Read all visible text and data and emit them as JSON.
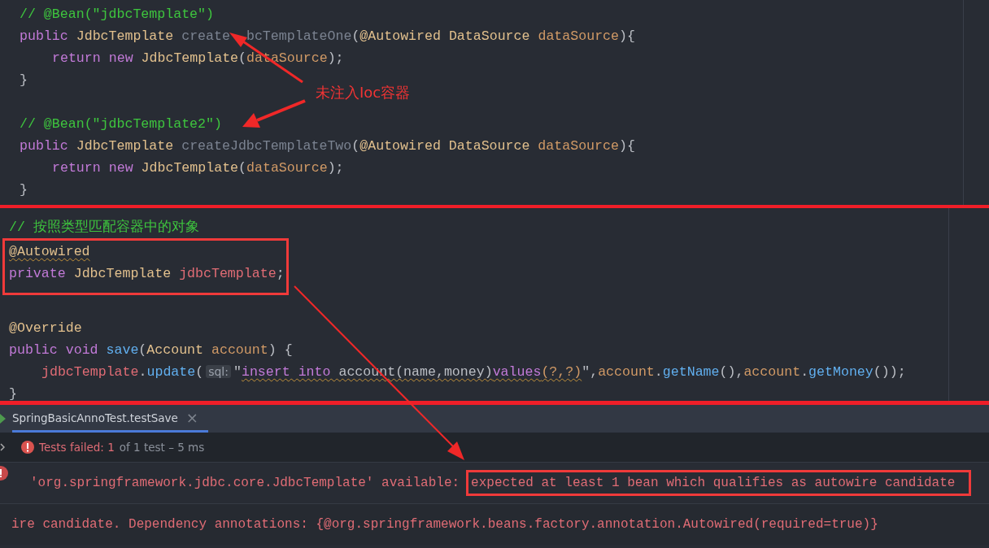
{
  "code_top": {
    "lines": [
      {
        "kind": "code",
        "indented": false,
        "tokens": [
          {
            "t": "// @Bean(\"jdbcTemplate\")",
            "kind": "comment"
          }
        ]
      },
      {
        "kind": "code",
        "indented": false,
        "tokens": [
          {
            "t": "public ",
            "kind": "keyword"
          },
          {
            "t": "JdbcTemplate ",
            "kind": "type"
          },
          {
            "t": "create",
            "kind": "unused"
          },
          {
            "t": "bcTemplateOne",
            "kind": "unused_covered"
          },
          {
            "t": "(",
            "kind": "plain"
          },
          {
            "t": "@Autowired ",
            "kind": "annotation"
          },
          {
            "t": "DataSource ",
            "kind": "type"
          },
          {
            "t": "dataSource",
            "kind": "param"
          },
          {
            "t": "){",
            "kind": "plain"
          }
        ]
      },
      {
        "kind": "code",
        "indented": true,
        "tokens": [
          {
            "t": "return ",
            "kind": "keyword"
          },
          {
            "t": "new ",
            "kind": "keyword"
          },
          {
            "t": "JdbcTemplate",
            "kind": "type"
          },
          {
            "t": "(",
            "kind": "plain"
          },
          {
            "t": "dataSource",
            "kind": "param"
          },
          {
            "t": ");",
            "kind": "plain"
          }
        ]
      },
      {
        "kind": "code",
        "indented": false,
        "tokens": [
          {
            "t": "}",
            "kind": "plain"
          }
        ]
      },
      {
        "kind": "blank"
      },
      {
        "kind": "code",
        "indented": false,
        "tokens": [
          {
            "t": "// @Bean(\"jdbcTemplate2\")",
            "kind": "comment"
          }
        ]
      },
      {
        "kind": "code",
        "indented": false,
        "tokens": [
          {
            "t": "public ",
            "kind": "keyword"
          },
          {
            "t": "JdbcTemplate ",
            "kind": "type"
          },
          {
            "t": "createJdbcTemplateTwo",
            "kind": "unused"
          },
          {
            "t": "(",
            "kind": "plain"
          },
          {
            "t": "@Autowired ",
            "kind": "annotation"
          },
          {
            "t": "DataSource ",
            "kind": "type"
          },
          {
            "t": "dataSource",
            "kind": "param"
          },
          {
            "t": "){",
            "kind": "plain"
          }
        ]
      },
      {
        "kind": "code",
        "indented": true,
        "tokens": [
          {
            "t": "return ",
            "kind": "keyword"
          },
          {
            "t": "new ",
            "kind": "keyword"
          },
          {
            "t": "JdbcTemplate",
            "kind": "type"
          },
          {
            "t": "(",
            "kind": "plain"
          },
          {
            "t": "dataSource",
            "kind": "param"
          },
          {
            "t": ");",
            "kind": "plain"
          }
        ]
      },
      {
        "kind": "code",
        "indented": false,
        "tokens": [
          {
            "t": "}",
            "kind": "plain"
          }
        ]
      }
    ]
  },
  "annotation": {
    "label": "未注入Ioc容器"
  },
  "code_bottom": {
    "lines": [
      {
        "kind": "code",
        "indented": false,
        "boxed": false,
        "tokens": [
          {
            "t": "// 按照类型匹配容器中的对象",
            "kind": "comment"
          }
        ]
      },
      {
        "kind": "code",
        "indented": false,
        "boxed": true,
        "tokens": [
          {
            "t": "@Autowired",
            "kind": "annotation_warn"
          }
        ]
      },
      {
        "kind": "code",
        "indented": false,
        "boxed": true,
        "tokens": [
          {
            "t": "private ",
            "kind": "keyword"
          },
          {
            "t": "JdbcTemplate ",
            "kind": "type"
          },
          {
            "t": "jdbcTemplate",
            "kind": "field"
          },
          {
            "t": ";",
            "kind": "plain"
          }
        ]
      },
      {
        "kind": "blank",
        "boxed": false
      },
      {
        "kind": "code",
        "indented": false,
        "boxed": false,
        "tokens": [
          {
            "t": "@Override",
            "kind": "annotation"
          }
        ]
      },
      {
        "kind": "code",
        "indented": false,
        "boxed": false,
        "tokens": [
          {
            "t": "public ",
            "kind": "keyword"
          },
          {
            "t": "void ",
            "kind": "keyword"
          },
          {
            "t": "save",
            "kind": "method"
          },
          {
            "t": "(",
            "kind": "plain"
          },
          {
            "t": "Account ",
            "kind": "type"
          },
          {
            "t": "account",
            "kind": "param"
          },
          {
            "t": ") {",
            "kind": "plain"
          }
        ]
      },
      {
        "kind": "code",
        "indented": true,
        "boxed": false,
        "tokens": [
          {
            "t": "jdbcTemplate",
            "kind": "field"
          },
          {
            "t": ".",
            "kind": "plain"
          },
          {
            "t": "update",
            "kind": "method"
          },
          {
            "t": "(",
            "kind": "plain"
          },
          {
            "t": "sql:",
            "kind": "hint"
          },
          {
            "t": "\"",
            "kind": "plain"
          },
          {
            "t": "insert into ",
            "kind": "sql_keyword"
          },
          {
            "t": "account(name,money)",
            "kind": "sql_plain"
          },
          {
            "t": "values",
            "kind": "sql_keyword"
          },
          {
            "t": "(?,?)",
            "kind": "sql_param"
          },
          {
            "t": "\",",
            "kind": "plain"
          },
          {
            "t": "account",
            "kind": "param"
          },
          {
            "t": ".",
            "kind": "plain"
          },
          {
            "t": "getName",
            "kind": "method"
          },
          {
            "t": "(),",
            "kind": "plain"
          },
          {
            "t": "account",
            "kind": "param"
          },
          {
            "t": ".",
            "kind": "plain"
          },
          {
            "t": "getMoney",
            "kind": "method"
          },
          {
            "t": "());",
            "kind": "plain"
          }
        ]
      },
      {
        "kind": "code",
        "indented": false,
        "boxed": false,
        "tokens": [
          {
            "t": "}",
            "kind": "plain"
          }
        ]
      }
    ]
  },
  "run_panel": {
    "tab": {
      "label": "SpringBasicAnnoTest.testSave",
      "selected": true,
      "close": "×"
    },
    "status": {
      "failed": "Tests failed: 1",
      "detail": "of 1 test – 5 ms"
    },
    "console": [
      {
        "text": "'org.springframework.jdbc.core.JdbcTemplate' available:",
        "boxed_text": "expected at least 1 bean which qualifies as autowire candidate"
      },
      {
        "text": "ire candidate. Dependency annotations: {@org.springframework.beans.factory.annotation.Autowired(required=true)}"
      }
    ]
  }
}
